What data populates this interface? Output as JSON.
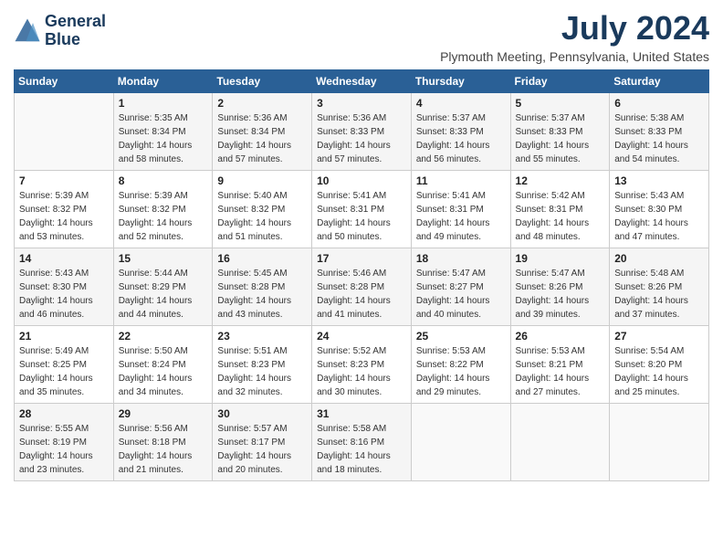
{
  "header": {
    "logo_line1": "General",
    "logo_line2": "Blue",
    "title": "July 2024",
    "subtitle": "Plymouth Meeting, Pennsylvania, United States"
  },
  "weekdays": [
    "Sunday",
    "Monday",
    "Tuesday",
    "Wednesday",
    "Thursday",
    "Friday",
    "Saturday"
  ],
  "weeks": [
    [
      {
        "day": "",
        "info": ""
      },
      {
        "day": "1",
        "info": "Sunrise: 5:35 AM\nSunset: 8:34 PM\nDaylight: 14 hours\nand 58 minutes."
      },
      {
        "day": "2",
        "info": "Sunrise: 5:36 AM\nSunset: 8:34 PM\nDaylight: 14 hours\nand 57 minutes."
      },
      {
        "day": "3",
        "info": "Sunrise: 5:36 AM\nSunset: 8:33 PM\nDaylight: 14 hours\nand 57 minutes."
      },
      {
        "day": "4",
        "info": "Sunrise: 5:37 AM\nSunset: 8:33 PM\nDaylight: 14 hours\nand 56 minutes."
      },
      {
        "day": "5",
        "info": "Sunrise: 5:37 AM\nSunset: 8:33 PM\nDaylight: 14 hours\nand 55 minutes."
      },
      {
        "day": "6",
        "info": "Sunrise: 5:38 AM\nSunset: 8:33 PM\nDaylight: 14 hours\nand 54 minutes."
      }
    ],
    [
      {
        "day": "7",
        "info": "Sunrise: 5:39 AM\nSunset: 8:32 PM\nDaylight: 14 hours\nand 53 minutes."
      },
      {
        "day": "8",
        "info": "Sunrise: 5:39 AM\nSunset: 8:32 PM\nDaylight: 14 hours\nand 52 minutes."
      },
      {
        "day": "9",
        "info": "Sunrise: 5:40 AM\nSunset: 8:32 PM\nDaylight: 14 hours\nand 51 minutes."
      },
      {
        "day": "10",
        "info": "Sunrise: 5:41 AM\nSunset: 8:31 PM\nDaylight: 14 hours\nand 50 minutes."
      },
      {
        "day": "11",
        "info": "Sunrise: 5:41 AM\nSunset: 8:31 PM\nDaylight: 14 hours\nand 49 minutes."
      },
      {
        "day": "12",
        "info": "Sunrise: 5:42 AM\nSunset: 8:31 PM\nDaylight: 14 hours\nand 48 minutes."
      },
      {
        "day": "13",
        "info": "Sunrise: 5:43 AM\nSunset: 8:30 PM\nDaylight: 14 hours\nand 47 minutes."
      }
    ],
    [
      {
        "day": "14",
        "info": "Sunrise: 5:43 AM\nSunset: 8:30 PM\nDaylight: 14 hours\nand 46 minutes."
      },
      {
        "day": "15",
        "info": "Sunrise: 5:44 AM\nSunset: 8:29 PM\nDaylight: 14 hours\nand 44 minutes."
      },
      {
        "day": "16",
        "info": "Sunrise: 5:45 AM\nSunset: 8:28 PM\nDaylight: 14 hours\nand 43 minutes."
      },
      {
        "day": "17",
        "info": "Sunrise: 5:46 AM\nSunset: 8:28 PM\nDaylight: 14 hours\nand 41 minutes."
      },
      {
        "day": "18",
        "info": "Sunrise: 5:47 AM\nSunset: 8:27 PM\nDaylight: 14 hours\nand 40 minutes."
      },
      {
        "day": "19",
        "info": "Sunrise: 5:47 AM\nSunset: 8:26 PM\nDaylight: 14 hours\nand 39 minutes."
      },
      {
        "day": "20",
        "info": "Sunrise: 5:48 AM\nSunset: 8:26 PM\nDaylight: 14 hours\nand 37 minutes."
      }
    ],
    [
      {
        "day": "21",
        "info": "Sunrise: 5:49 AM\nSunset: 8:25 PM\nDaylight: 14 hours\nand 35 minutes."
      },
      {
        "day": "22",
        "info": "Sunrise: 5:50 AM\nSunset: 8:24 PM\nDaylight: 14 hours\nand 34 minutes."
      },
      {
        "day": "23",
        "info": "Sunrise: 5:51 AM\nSunset: 8:23 PM\nDaylight: 14 hours\nand 32 minutes."
      },
      {
        "day": "24",
        "info": "Sunrise: 5:52 AM\nSunset: 8:23 PM\nDaylight: 14 hours\nand 30 minutes."
      },
      {
        "day": "25",
        "info": "Sunrise: 5:53 AM\nSunset: 8:22 PM\nDaylight: 14 hours\nand 29 minutes."
      },
      {
        "day": "26",
        "info": "Sunrise: 5:53 AM\nSunset: 8:21 PM\nDaylight: 14 hours\nand 27 minutes."
      },
      {
        "day": "27",
        "info": "Sunrise: 5:54 AM\nSunset: 8:20 PM\nDaylight: 14 hours\nand 25 minutes."
      }
    ],
    [
      {
        "day": "28",
        "info": "Sunrise: 5:55 AM\nSunset: 8:19 PM\nDaylight: 14 hours\nand 23 minutes."
      },
      {
        "day": "29",
        "info": "Sunrise: 5:56 AM\nSunset: 8:18 PM\nDaylight: 14 hours\nand 21 minutes."
      },
      {
        "day": "30",
        "info": "Sunrise: 5:57 AM\nSunset: 8:17 PM\nDaylight: 14 hours\nand 20 minutes."
      },
      {
        "day": "31",
        "info": "Sunrise: 5:58 AM\nSunset: 8:16 PM\nDaylight: 14 hours\nand 18 minutes."
      },
      {
        "day": "",
        "info": ""
      },
      {
        "day": "",
        "info": ""
      },
      {
        "day": "",
        "info": ""
      }
    ]
  ]
}
